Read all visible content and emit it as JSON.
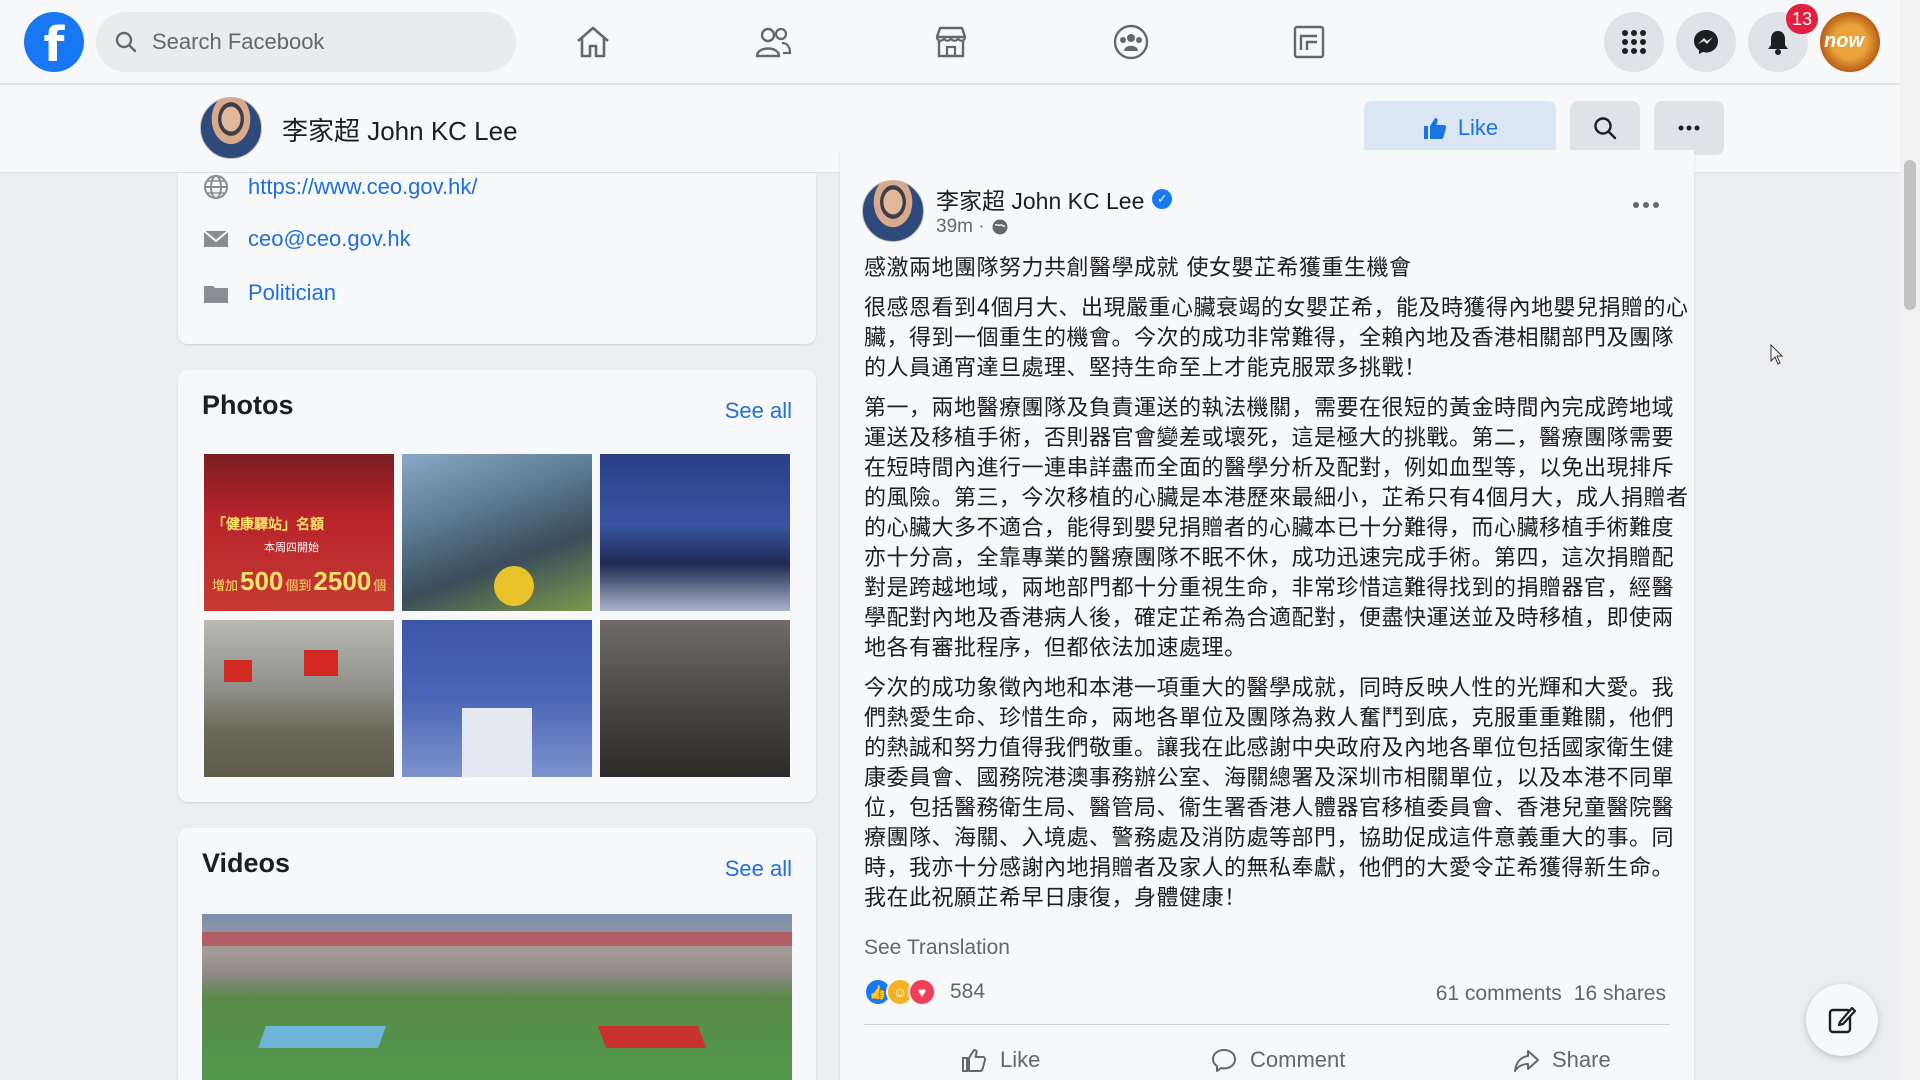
{
  "topbar": {
    "search_placeholder": "Search Facebook",
    "notification_count": "13",
    "avatar_text": "now",
    "nav_icons": [
      "home-icon",
      "friends-icon",
      "marketplace-icon",
      "groups-icon",
      "gaming-icon"
    ],
    "right_icons": [
      "menu-grid-icon",
      "messenger-icon",
      "notifications-icon"
    ]
  },
  "page_header": {
    "name": "李家超 John KC Lee",
    "like_label": "Like"
  },
  "intro": {
    "website": "https://www.ceo.gov.hk/",
    "email": "ceo@ceo.gov.hk",
    "category": "Politician"
  },
  "photos": {
    "title": "Photos",
    "see_all": "See all",
    "captions": [
      "「健康驛站」名額",
      "本周四開始",
      "增加",
      "500",
      "個到",
      "2500",
      "個"
    ]
  },
  "videos": {
    "title": "Videos",
    "see_all": "See all"
  },
  "post": {
    "author": "李家超 John KC Lee",
    "time": "39m ·",
    "paragraphs": [
      "感激兩地團隊努力共創醫學成就 使女嬰芷希獲重生機會",
      "很感恩看到4個月大、出現嚴重心臟衰竭的女嬰芷希，能及時獲得內地嬰兒捐贈的心臟，得到一個重生的機會。今次的成功非常難得，全賴內地及香港相關部門及團隊的人員通宵達旦處理、堅持生命至上才能克服眾多挑戰！",
      "第一，兩地醫療團隊及負責運送的執法機關，需要在很短的黃金時間內完成跨地域運送及移植手術，否則器官會變差或壞死，這是極大的挑戰。第二，醫療團隊需要在短時間內進行一連串詳盡而全面的醫學分析及配對，例如血型等，以免出現排斥的風險。第三，今次移植的心臟是本港歷來最細小，芷希只有4個月大，成人捐贈者的心臟大多不適合，能得到嬰兒捐贈者的心臟本已十分難得，而心臟移植手術難度亦十分高，全靠專業的醫療團隊不眠不休，成功迅速完成手術。第四，這次捐贈配對是跨越地域，兩地部門都十分重視生命，非常珍惜這難得找到的捐贈器官，經醫學配對內地及香港病人後，確定芷希為合適配對，便盡快運送並及時移植，即使兩地各有審批程序，但都依法加速處理。",
      "今次的成功象徵內地和本港一項重大的醫學成就，同時反映人性的光輝和大愛。我們熱愛生命、珍惜生命，兩地各單位及團隊為救人奮鬥到底，克服重重難關，他們的熱誠和努力值得我們敬重。讓我在此感謝中央政府及內地各單位包括國家衛生健康委員會、國務院港澳事務辦公室、海關總署及深圳市相關單位，以及本港不同單位，包括醫務衛生局、醫管局、衞生署香港人體器官移植委員會、香港兒童醫院醫療團隊、海關、入境處、警務處及消防處等部門，協助促成這件意義重大的事。同時，我亦十分感謝內地捐贈者及家人的無私奉獻，他們的大愛令芷希獲得新生命。我在此祝願芷希早日康復，身體健康！"
    ],
    "see_translation": "See Translation",
    "reaction_count": "584",
    "comments": "61 comments",
    "shares": "16 shares",
    "actions": {
      "like": "Like",
      "comment": "Comment",
      "share": "Share"
    }
  },
  "colors": {
    "brand_blue": "#1877f2",
    "link_blue": "#216fdb",
    "badge_red": "#e41e3f"
  }
}
